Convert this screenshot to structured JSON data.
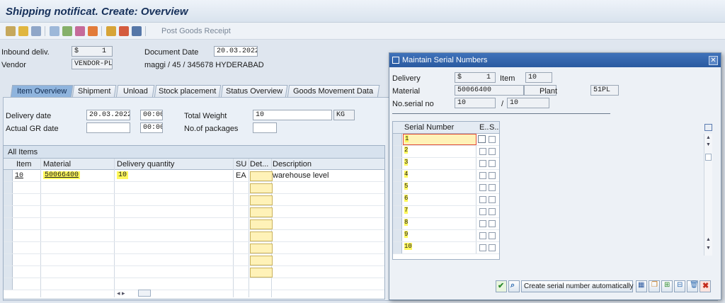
{
  "window": {
    "title": "Shipping notificat. Create: Overview"
  },
  "toolbar": {
    "post_goods_receipt": "Post Goods Receipt"
  },
  "header": {
    "inbound_deliv_label": "Inbound deliv.",
    "inbound_deliv_prefix": "$",
    "inbound_deliv_value": "1",
    "vendor_label": "Vendor",
    "vendor_value": "VENDOR-PL",
    "document_date_label": "Document Date",
    "document_date_value": "20.03.2022",
    "vendor_address": "maggi / 45 / 345678 HYDERABAD"
  },
  "tabs": [
    "Item Overview",
    "Shipment",
    "Unload",
    "Stock placement",
    "Status Overview",
    "Goods Movement Data"
  ],
  "overview": {
    "delivery_date_label": "Delivery date",
    "delivery_date_value": "20.03.2022",
    "delivery_time_value": "00:00",
    "actual_gr_label": "Actual GR date",
    "actual_gr_time_value": "00:00",
    "total_weight_label": "Total Weight",
    "total_weight_value": "10",
    "weight_unit": "KG",
    "packages_label": "No.of packages"
  },
  "items_table": {
    "title": "All Items",
    "columns": [
      "Item",
      "Material",
      "Delivery quantity",
      "SU",
      "Det...",
      "Description"
    ],
    "rows": [
      {
        "item": "10",
        "material": "50066400",
        "quantity": "10",
        "su": "EA",
        "description": "warehouse level"
      }
    ]
  },
  "dialog": {
    "title": "Maintain Serial Numbers",
    "delivery_label": "Delivery",
    "delivery_prefix": "$",
    "delivery_value": "1",
    "item_label": "Item",
    "item_value": "10",
    "material_label": "Material",
    "material_value": "50066400",
    "plant_label": "Plant",
    "plant_value": "51PL",
    "no_serial_label": "No.serial no",
    "no_serial_value": "10",
    "no_serial_total": "10",
    "grid_columns": [
      "Serial Number",
      "E..",
      "S.."
    ],
    "serial_rows": [
      "1",
      "2",
      "3",
      "4",
      "5",
      "6",
      "7",
      "8",
      "9",
      "10"
    ],
    "create_auto_button": "Create serial number automatically"
  },
  "colors": {
    "highlight": "#fff85c",
    "title_bar": "#2a5aa0",
    "active_tab": "#8fb4dd"
  }
}
